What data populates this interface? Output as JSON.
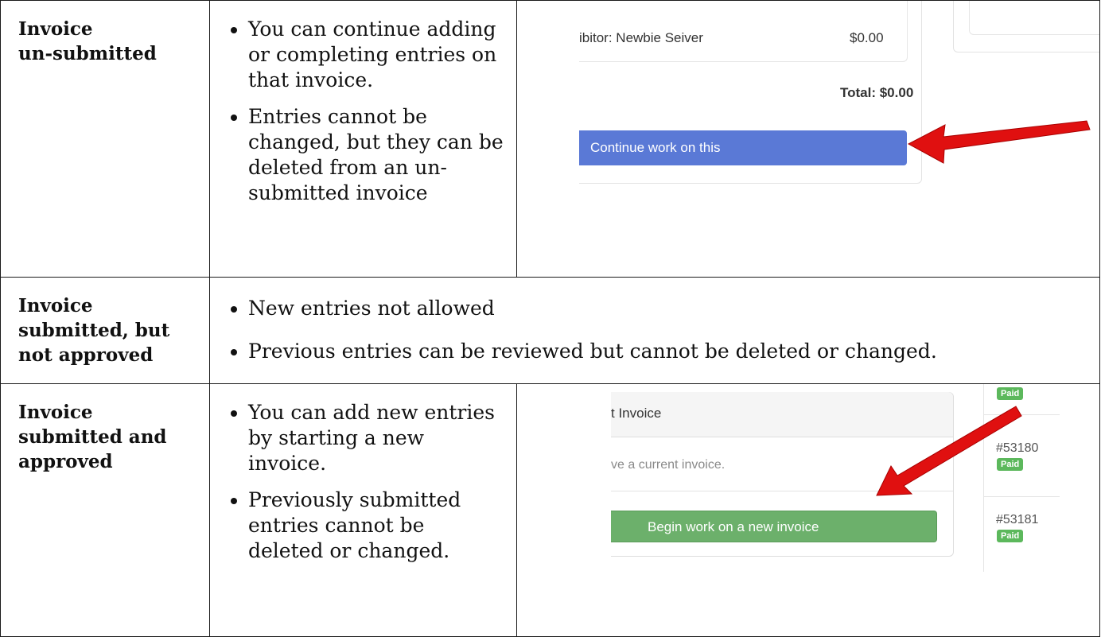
{
  "rows": [
    {
      "label": [
        "Invoice",
        "un-submitted"
      ],
      "bullets": [
        "You can continue adding or completing entries on that invoice.",
        "Entries cannot be changed, but they can be deleted from an un-submitted invoice"
      ]
    },
    {
      "label": [
        "Invoice",
        "submitted, but",
        "not approved"
      ],
      "bullets": [
        "New entries not allowed",
        "Previous entries can be reviewed but cannot be deleted or changed."
      ]
    },
    {
      "label": [
        "Invoice",
        "submitted and",
        "approved"
      ],
      "bullets": [
        "You can add new entries by starting a new invoice.",
        "Previously submitted entries cannot be deleted or changed."
      ]
    }
  ],
  "screenshot_1": {
    "exhibitor_text": "ibitor: Newbie Seiver",
    "amount": "$0.00",
    "total": "Total: $0.00",
    "button_label": "Continue work on this",
    "button_color": "#5a79d6",
    "arrow_color": "#e01010"
  },
  "screenshot_3": {
    "panel_title": "t Invoice",
    "panel_text": "ve a current invoice.",
    "button_label": "Begin work on a new invoice",
    "button_color": "#6cb06b",
    "invoices": [
      {
        "number": "",
        "status": "Paid"
      },
      {
        "number": "#53180",
        "status": "Paid"
      },
      {
        "number": "#53181",
        "status": "Paid"
      }
    ],
    "badge_color": "#5cb85c"
  }
}
